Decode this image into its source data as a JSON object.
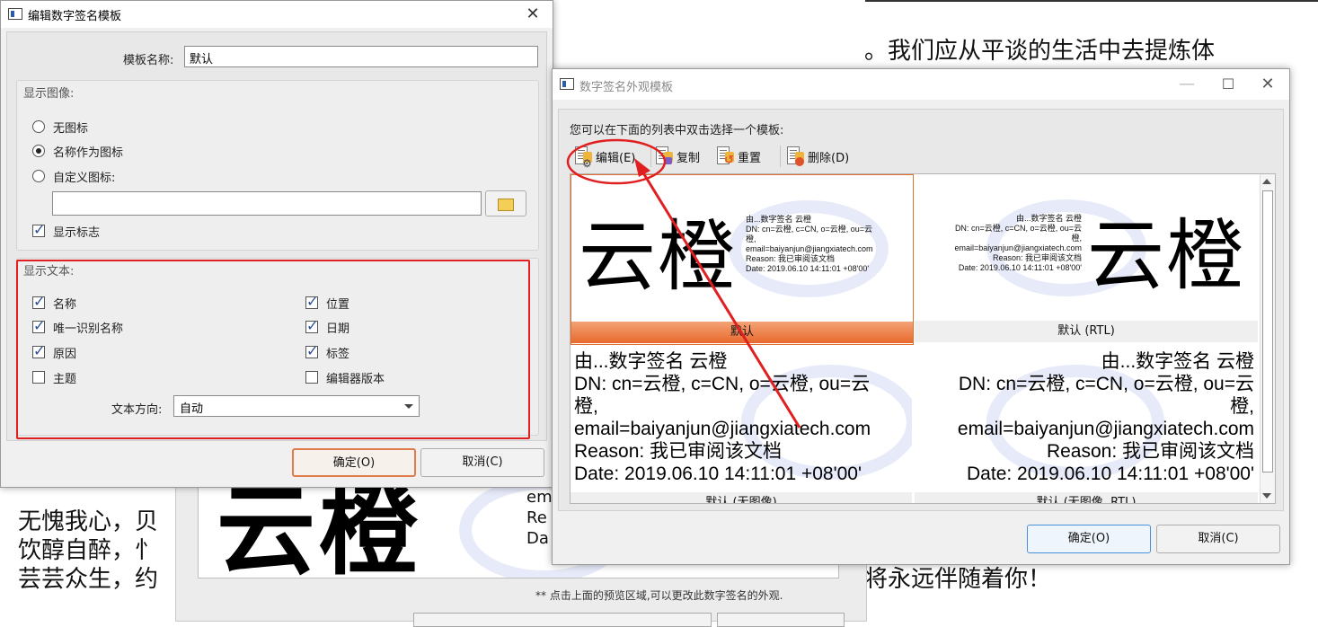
{
  "background_doc": {
    "right_lines": [
      "。我们应从平谈的生活中去提炼体",
      "将永远伴随着你！"
    ],
    "left_lines": [
      "无愧我心，贝",
      "饮醇自醉，忄",
      "芸芸众生，约"
    ],
    "preview_name": "云橙",
    "preview_lines": [
      "em",
      "Re",
      "Da"
    ],
    "note": "** 点击上面的预览区域,可以更改此数字签名的外观."
  },
  "edit_dialog": {
    "title": "编辑数字签名模板",
    "close_glyph": "✕",
    "template_name_label": "模板名称:",
    "template_name_value": "默认",
    "display_image": {
      "group_label": "显示图像:",
      "options": [
        "无图标",
        "名称作为图标",
        "自定义图标:"
      ],
      "selected": "名称作为图标",
      "custom_icon_path": "",
      "show_logo_label": "显示标志",
      "show_logo_checked": true
    },
    "display_text": {
      "group_label": "显示文本:",
      "left": [
        {
          "label": "名称",
          "checked": true
        },
        {
          "label": "唯一识别名称",
          "checked": true
        },
        {
          "label": "原因",
          "checked": true
        },
        {
          "label": "主题",
          "checked": false
        }
      ],
      "right": [
        {
          "label": "位置",
          "checked": true
        },
        {
          "label": "日期",
          "checked": true
        },
        {
          "label": "标签",
          "checked": true
        },
        {
          "label": "编辑器版本",
          "checked": false
        }
      ],
      "direction_label": "文本方向:",
      "direction_value": "自动"
    },
    "ok_label": "确定(O)",
    "cancel_label": "取消(C)"
  },
  "appearance_dialog": {
    "title": "数字签名外观模板",
    "min_glyph": "—",
    "max_glyph": "☐",
    "close_glyph": "✕",
    "instruction": "您可以在下面的列表中双击选择一个模板:",
    "toolbar": {
      "edit": "编辑(E)",
      "copy": "复制",
      "reset": "重置",
      "delete": "删除(D)"
    },
    "templates": [
      {
        "caption": "默认",
        "selected": true,
        "name": "云橙",
        "lines": [
          "由...数字签名 云橙",
          "DN: cn=云橙, c=CN, o=云橙, ou=云",
          "橙,",
          "email=baiyanjun@jiangxiatech.com",
          "Reason: 我已审阅该文档",
          "Date: 2019.06.10 14:11:01 +08'00'"
        ]
      },
      {
        "caption": "默认 (RTL)",
        "selected": false,
        "name": "云橙",
        "lines": [
          "由...数字签名 云橙",
          "DN: cn=云橙, c=CN, o=云橙, ou=云",
          "橙,",
          "email=baiyanjun@jiangxiatech.com",
          "Reason: 我已审阅该文档",
          "Date: 2019.06.10 14:11:01 +08'00'"
        ]
      },
      {
        "caption": "默认 (无图像)",
        "selected": false,
        "lines": [
          "由...数字签名 云橙",
          "DN: cn=云橙, c=CN, o=云橙, ou=云",
          "橙,",
          "email=baiyanjun@jiangxiatech.com",
          "Reason: 我已审阅该文档",
          "Date: 2019.06.10 14:11:01 +08'00'"
        ]
      },
      {
        "caption": "默认 (无图像, RTL)",
        "selected": false,
        "lines": [
          "由...数字签名 云橙",
          "DN: cn=云橙, c=CN, o=云橙, ou=云",
          "橙,",
          "email=baiyanjun@jiangxiatech.com",
          "Reason: 我已审阅该文档",
          "Date: 2019.06.10 14:11:01 +08'00'"
        ]
      }
    ],
    "ok_label": "确定(O)",
    "cancel_label": "取消(C)"
  },
  "colors": {
    "annotation_red": "#e02020",
    "selected_orange": "#e8692c",
    "focus_blue": "#4a8fd9"
  }
}
